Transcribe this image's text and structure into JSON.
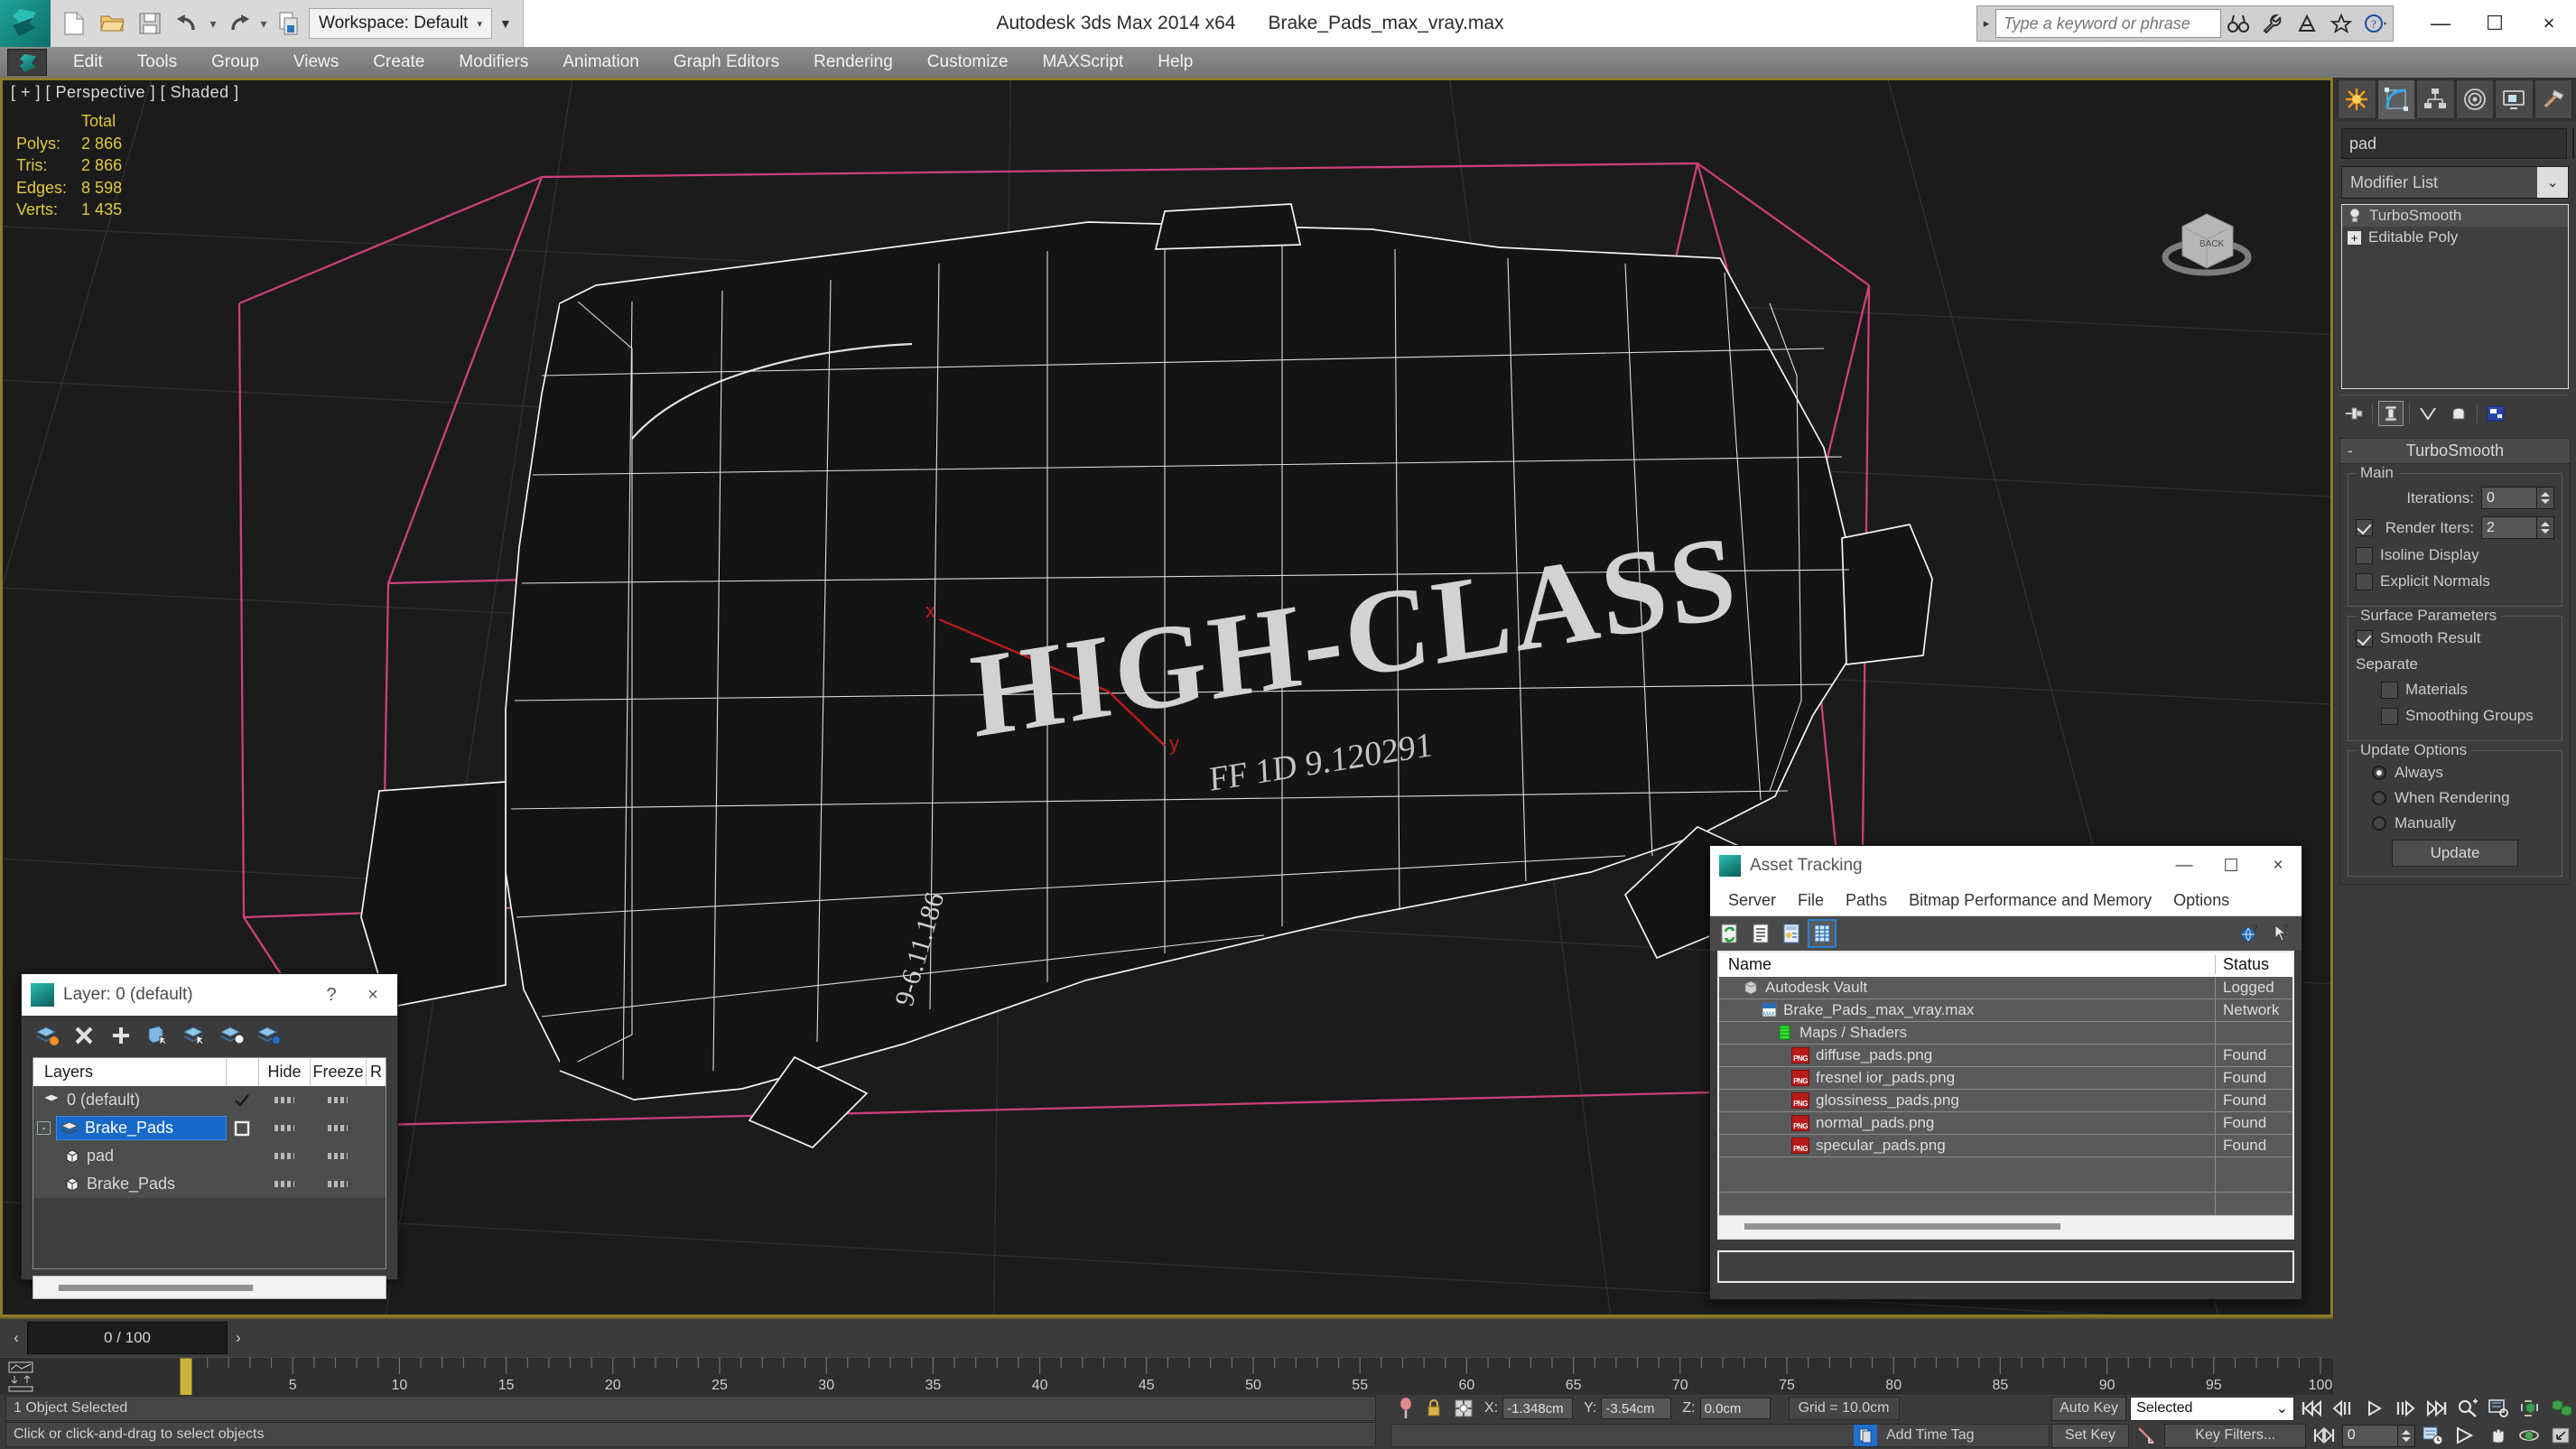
{
  "app": {
    "title": "Autodesk 3ds Max  2014 x64",
    "file": "Brake_Pads_max_vray.max",
    "workspace_label": "Workspace: Default"
  },
  "titlebar": {
    "search_placeholder": "Type a keyword or phrase",
    "icons": [
      "new-icon",
      "open-icon",
      "save-icon",
      "undo-icon",
      "redo-icon",
      "set-project-folder-icon"
    ],
    "right_icons": [
      "binoculars-icon",
      "wrench-icon",
      "satellite-icon",
      "star-icon",
      "help-icon"
    ],
    "minimize": "—",
    "maximize": "☐",
    "close": "×"
  },
  "menu": {
    "items": [
      "Edit",
      "Tools",
      "Group",
      "Views",
      "Create",
      "Modifiers",
      "Animation",
      "Graph Editors",
      "Rendering",
      "Customize",
      "MAXScript",
      "Help"
    ]
  },
  "viewport": {
    "label": "[ + ] [ Perspective ] [ Shaded ]",
    "stats_header": "Total",
    "stats": [
      {
        "name": "Polys:",
        "value": "2 866"
      },
      {
        "name": "Tris:",
        "value": "2 866"
      },
      {
        "name": "Edges:",
        "value": "8 598"
      },
      {
        "name": "Verts:",
        "value": "1 435"
      }
    ],
    "model_text": "HIGH-CLASS",
    "model_subtext": "FF 1D 9.120291",
    "axis_x": "x",
    "axis_y": "y",
    "viewcube_face": "BACK"
  },
  "command_panel": {
    "tabs": [
      "create-tab",
      "modify-tab",
      "hierarchy-tab",
      "motion-tab",
      "display-tab",
      "utilities-tab"
    ],
    "active_tab_index": 1,
    "object_name": "pad",
    "modifier_list_label": "Modifier List",
    "stack": [
      {
        "label": "TurboSmooth",
        "icon": "light-bulb-icon",
        "selected": true
      },
      {
        "label": "Editable Poly",
        "icon": "plus-expand-icon",
        "selected": false
      }
    ],
    "stack_tools": [
      "pin-stack-icon",
      "show-end-result-icon",
      "make-unique-icon",
      "remove-modifier-icon",
      "configure-modifier-sets-icon"
    ],
    "rollout": {
      "title": "TurboSmooth",
      "collapse_glyph": "-",
      "groups": {
        "main": {
          "label": "Main",
          "iterations_label": "Iterations:",
          "iterations_value": "0",
          "render_iters_label": "Render Iters:",
          "render_iters_value": "2",
          "render_iters_checked": true,
          "isoline_display_label": "Isoline Display",
          "isoline_display_checked": false,
          "explicit_normals_label": "Explicit Normals",
          "explicit_normals_checked": false
        },
        "surface": {
          "label": "Surface Parameters",
          "smooth_result_label": "Smooth Result",
          "smooth_result_checked": true,
          "separate_label": "Separate",
          "materials_label": "Materials",
          "materials_checked": false,
          "smoothing_groups_label": "Smoothing Groups",
          "smoothing_groups_checked": false
        },
        "update": {
          "label": "Update Options",
          "options": [
            "Always",
            "When Rendering",
            "Manually"
          ],
          "selected_index": 0,
          "update_button": "Update"
        }
      }
    }
  },
  "layer_dialog": {
    "title": "Layer: 0 (default)",
    "help_glyph": "?",
    "close_glyph": "×",
    "toolbar_icons": [
      "create-new-layer-icon",
      "delete-layer-icon",
      "add-layer-icon",
      "select-objects-in-layer-icon",
      "select-highlighted-objects-icon",
      "highlight-selected-objects-icon",
      "layer-properties-icon"
    ],
    "columns": [
      "Layers",
      "",
      "Hide",
      "Freeze",
      "R"
    ],
    "rows": [
      {
        "name": "0 (default)",
        "icon": "layers-icon",
        "indent": 0,
        "active": true,
        "selected": false,
        "checkbox": false,
        "hide": "dash",
        "freeze": "dash"
      },
      {
        "name": "Brake_Pads",
        "icon": "layers-icon",
        "indent": 0,
        "active": false,
        "selected": true,
        "checkbox": true,
        "hide": "dash",
        "freeze": "dash",
        "expander": "-"
      },
      {
        "name": "pad",
        "icon": "cube-icon",
        "indent": 1,
        "active": false,
        "selected": false,
        "checkbox": false,
        "hide": "dash",
        "freeze": "dash"
      },
      {
        "name": "Brake_Pads",
        "icon": "cube-icon",
        "indent": 1,
        "active": false,
        "selected": false,
        "checkbox": false,
        "hide": "dash",
        "freeze": "dash"
      }
    ]
  },
  "asset_tracking": {
    "title": "Asset Tracking",
    "window_buttons": {
      "minimize": "—",
      "maximize": "☐",
      "close": "×"
    },
    "menu": [
      "Server",
      "File",
      "Paths",
      "Bitmap Performance and Memory",
      "Options"
    ],
    "toolbar_icons": [
      "refresh-icon",
      "list-view-icon",
      "detail-view-icon",
      "grid-view-icon"
    ],
    "toolbar_right_icons": [
      "help-globe-icon",
      "help-pointer-icon"
    ],
    "active_tool_index": 3,
    "columns": [
      "Name",
      "Status"
    ],
    "rows": [
      {
        "name": "Autodesk Vault",
        "status": "Logged",
        "indent": 0,
        "icon": "vault-icon"
      },
      {
        "name": "Brake_Pads_max_vray.max",
        "status": "Network",
        "indent": 1,
        "icon": "max-file-icon"
      },
      {
        "name": "Maps / Shaders",
        "status": "",
        "indent": 2,
        "icon": "maps-shaders-icon"
      },
      {
        "name": "diffuse_pads.png",
        "status": "Found",
        "indent": 3,
        "icon": "png-icon"
      },
      {
        "name": "fresnel ior_pads.png",
        "status": "Found",
        "indent": 3,
        "icon": "png-icon"
      },
      {
        "name": "glossiness_pads.png",
        "status": "Found",
        "indent": 3,
        "icon": "png-icon"
      },
      {
        "name": "normal_pads.png",
        "status": "Found",
        "indent": 3,
        "icon": "png-icon"
      },
      {
        "name": "specular_pads.png",
        "status": "Found",
        "indent": 3,
        "icon": "png-icon"
      }
    ]
  },
  "timeline": {
    "current": "0 / 100",
    "prev_glyph": "‹",
    "next_glyph": "›",
    "labels": [
      "5",
      "10",
      "15",
      "20",
      "25",
      "30",
      "35",
      "40",
      "45",
      "50",
      "55",
      "60",
      "65",
      "70",
      "75",
      "80",
      "85",
      "90",
      "95",
      "100"
    ],
    "slider_frame": 0,
    "range_start": 0,
    "range_end": 100
  },
  "statusbar": {
    "selection": "1 Object Selected",
    "prompt": "Click or click-and-drag to select objects",
    "x_label": "X:",
    "x_value": "-1.348cm",
    "y_label": "Y:",
    "y_value": "-3.54cm",
    "z_label": "Z:",
    "z_value": "0.0cm",
    "grid": "Grid = 10.0cm",
    "add_time_tag": "Add Time Tag",
    "auto_key": "Auto Key",
    "set_key": "Set Key",
    "key_filters": "Key Filters...",
    "selection_level": "Selected",
    "frame_field": "0",
    "icons": [
      "pin-icon",
      "lock-selection-icon",
      "absolute-relative-icon",
      "key-mode-icon"
    ],
    "playback_icons": [
      "go-to-start-icon",
      "previous-frame-icon",
      "play-icon",
      "next-frame-icon",
      "go-to-end-icon"
    ],
    "nav_icons": [
      "zoom-icon",
      "zoom-all-icon",
      "zoom-extents-icon",
      "zoom-region-icon",
      "pan-icon",
      "orbit-icon",
      "maximize-viewport-icon",
      "field-of-view-icon",
      "walkthrough-icon"
    ]
  },
  "colors": {
    "accent_yellow": "#e2c93a",
    "selection_blue": "#1669c8",
    "viewport_bg": "#1b1b1b",
    "panel_bg": "#3b3b3b"
  }
}
